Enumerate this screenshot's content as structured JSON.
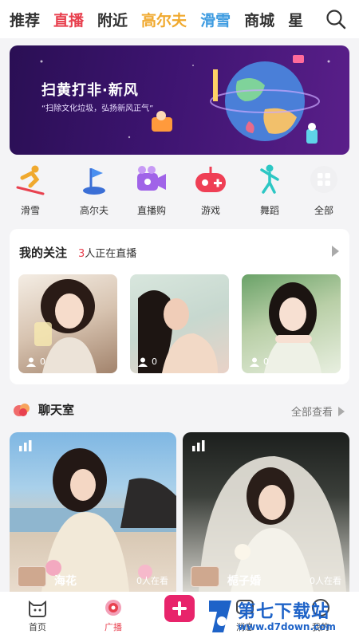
{
  "top_nav": {
    "tabs": [
      {
        "label": "推荐"
      },
      {
        "label": "直播"
      },
      {
        "label": "附近"
      },
      {
        "label": "高尔夫"
      },
      {
        "label": "滑雪"
      },
      {
        "label": "商城"
      },
      {
        "label": "星"
      }
    ],
    "active_tab": "直播",
    "search_icon": "search-icon"
  },
  "banner": {
    "title": "扫黄打非·新风",
    "subtitle": "“扫除文化垃圾，弘扬新风正气”"
  },
  "categories": [
    {
      "label": "滑雪",
      "icon": "ski-icon"
    },
    {
      "label": "高尔夫",
      "icon": "golf-flag-icon"
    },
    {
      "label": "直播购",
      "icon": "video-camera-icon"
    },
    {
      "label": "游戏",
      "icon": "gamepad-icon"
    },
    {
      "label": "舞蹈",
      "icon": "dancer-icon"
    },
    {
      "label": "全部",
      "icon": "grid-icon"
    }
  ],
  "follow": {
    "title": "我的关注",
    "live_count": "3",
    "live_text": "人正在直播",
    "thumbs": [
      {
        "viewers": "0"
      },
      {
        "viewers": "0"
      },
      {
        "viewers": "0"
      }
    ]
  },
  "chatroom": {
    "title": "聊天室",
    "view_all": "全部查看",
    "rooms": [
      {
        "name": "海花",
        "count": "0人在看"
      },
      {
        "name": "栀子婚",
        "count": "0人在看"
      }
    ]
  },
  "bottom_bar": {
    "items": [
      {
        "label": "首页"
      },
      {
        "label": "广播"
      },
      {
        "label": "消息"
      },
      {
        "label": "我的"
      }
    ],
    "active": "广播"
  },
  "watermark": {
    "text": "第七下载站",
    "url": "www.d7down.com"
  },
  "colors": {
    "accent": "#e8414f",
    "gold_tab": "#f0a92e",
    "blue_tab": "#3d9be0",
    "publish": "#e8246b"
  }
}
